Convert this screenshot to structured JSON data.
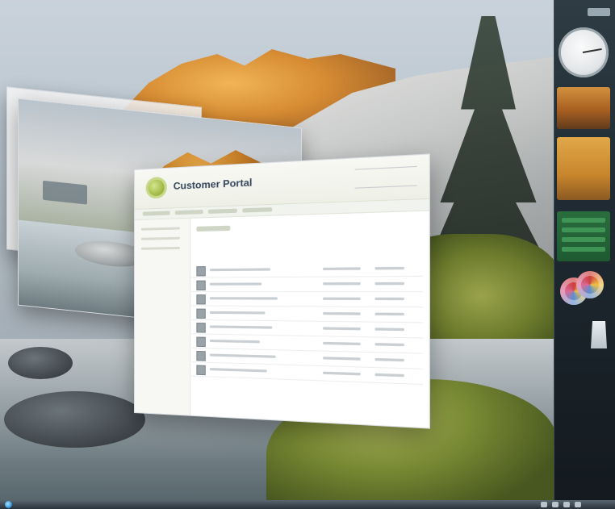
{
  "window_main": {
    "title": "Customer Portal"
  },
  "gadgets": {
    "clock": "clock-icon",
    "photo": "photo-gadget",
    "feed": "feed-gadget",
    "media": "cd-icon",
    "recycle_bin": "recycle-bin-icon"
  },
  "colors": {
    "accent_green": "#99b23a",
    "sidebar_dark": "#1f2a32"
  }
}
